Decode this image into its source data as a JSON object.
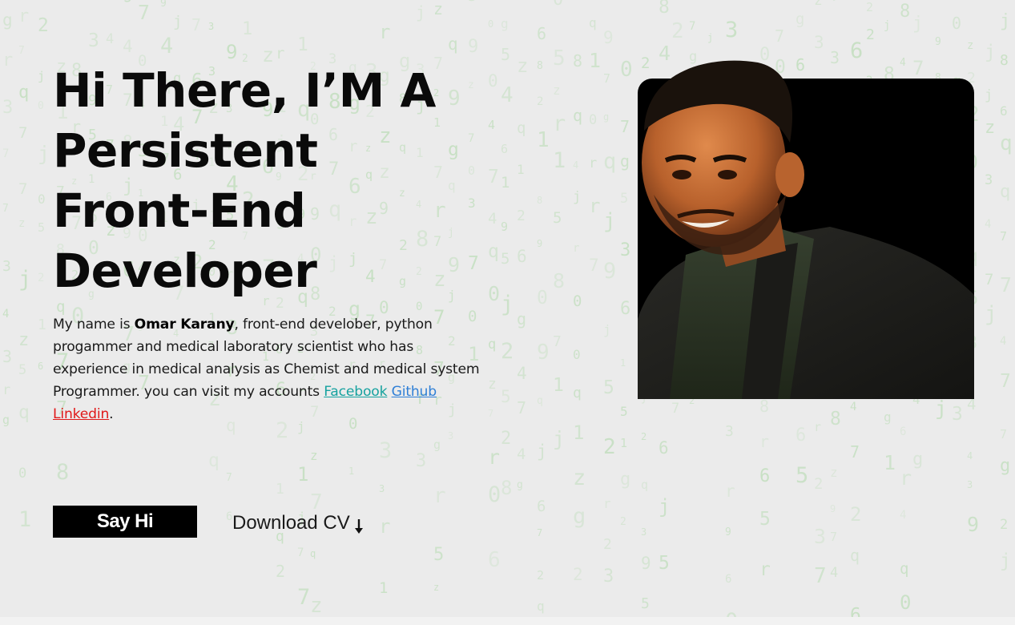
{
  "hero": {
    "title_lines": [
      "Hi There, I’M A",
      "Persistent",
      "Front-End",
      "Developer"
    ],
    "intro": {
      "prefix": "My name is ",
      "name": "Omar Karany",
      "body": ", front-end develober, python progammer and medical laboratory scientist who has experience in medical analysis as Chemist and medical system Programmer. you can visit my accounts ",
      "links": {
        "facebook": "Facebook",
        "github": "Github",
        "linkedin": "Linkedin"
      },
      "suffix": "."
    },
    "say_hi_label": "Say Hi",
    "download_label": "Download CV"
  },
  "colors": {
    "background": "#ebebeb",
    "button": "#000000",
    "facebook_link": "#17a2a0",
    "github_link": "#2f7fd6",
    "linkedin_link": "#e01919",
    "matrix_rain": "#b9dcb4"
  },
  "icons": {
    "download": "arrow-down-icon"
  }
}
